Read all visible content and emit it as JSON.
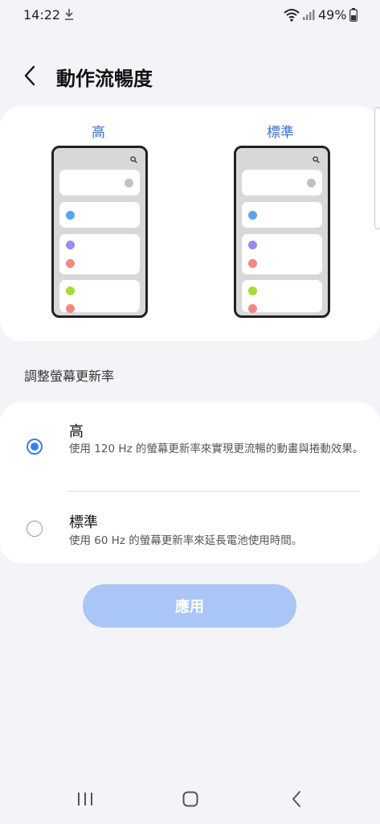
{
  "status_bar": {
    "time": "14:22",
    "battery_percent": "49%"
  },
  "header": {
    "title": "動作流暢度"
  },
  "preview": {
    "left_label": "高",
    "right_label": "標準",
    "dot_colors": [
      "#5aa3ec",
      "#9b8aef",
      "#ef8a7e",
      "#a5dc3a"
    ]
  },
  "section_label": "調整螢幕更新率",
  "options": [
    {
      "title": "高",
      "description": "使用 120 Hz 的螢幕更新率來實現更流暢的動畫與捲動效果。",
      "selected": true
    },
    {
      "title": "標準",
      "description": "使用 60 Hz 的螢幕更新率來延長電池使用時間。",
      "selected": false
    }
  ],
  "apply_button": "應用",
  "colors": {
    "accent": "#3d7de8",
    "preview_label": "#3a6fc8",
    "apply_button_bg": "#a9c6f7"
  }
}
